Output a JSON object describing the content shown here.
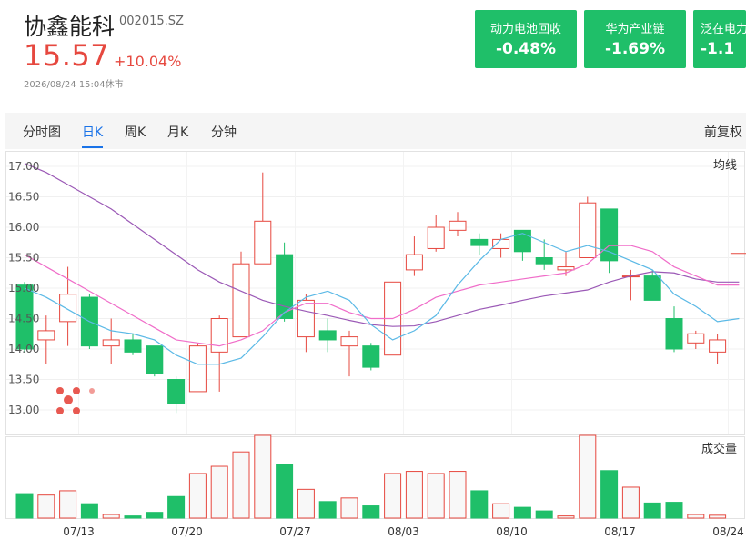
{
  "header": {
    "name": "协鑫能科",
    "code": "002015.SZ",
    "price": "15.57",
    "change": "+10.04%",
    "timestamp": "2026/08/24 15:04休市"
  },
  "sectors": [
    {
      "name": "动力电池回收",
      "value": "-0.48%"
    },
    {
      "name": "华为产业链",
      "value": "-1.69%"
    },
    {
      "name": "泛在电力",
      "value": "-1.1"
    }
  ],
  "tabs": [
    "分时图",
    "日K",
    "周K",
    "月K",
    "分钟"
  ],
  "active_tab": "日K",
  "restore_label": "前复权",
  "colors": {
    "up": "#e6483f",
    "down": "#1fbf69",
    "ma5": "#5bb9e6",
    "ma10": "#f06dc9",
    "ma20": "#9b59b6",
    "accent": "#1a73e8"
  },
  "chart_data": {
    "type": "candlestick",
    "price_legend": "均线",
    "volume_legend": "成交量",
    "ylim": [
      12.8,
      17.05
    ],
    "yticks": [
      "13.00",
      "13.50",
      "14.00",
      "14.50",
      "15.00",
      "15.50",
      "16.00",
      "16.50",
      "17.00"
    ],
    "xticks": [
      {
        "label": "07/13",
        "index": 2.5
      },
      {
        "label": "07/20",
        "index": 7.5
      },
      {
        "label": "07/27",
        "index": 12.5
      },
      {
        "label": "08/03",
        "index": 17.5
      },
      {
        "label": "08/10",
        "index": 22.5
      },
      {
        "label": "08/17",
        "index": 27.5
      },
      {
        "label": "08/24",
        "index": 32.5
      }
    ],
    "candles": [
      {
        "o": 15.05,
        "h": 15.1,
        "l": 13.95,
        "c": 14.0,
        "v": 34
      },
      {
        "o": 14.15,
        "h": 14.55,
        "l": 13.75,
        "c": 14.3,
        "v": 32
      },
      {
        "o": 14.45,
        "h": 15.35,
        "l": 14.05,
        "c": 14.9,
        "v": 38
      },
      {
        "o": 14.85,
        "h": 14.9,
        "l": 14.0,
        "c": 14.05,
        "v": 20
      },
      {
        "o": 14.05,
        "h": 14.5,
        "l": 13.75,
        "c": 14.15,
        "v": 5
      },
      {
        "o": 14.15,
        "h": 14.25,
        "l": 13.9,
        "c": 13.95,
        "v": 3
      },
      {
        "o": 14.05,
        "h": 14.05,
        "l": 13.55,
        "c": 13.6,
        "v": 8
      },
      {
        "o": 13.5,
        "h": 13.55,
        "l": 12.95,
        "c": 13.1,
        "v": 30
      },
      {
        "o": 13.3,
        "h": 14.1,
        "l": 13.3,
        "c": 14.05,
        "v": 62
      },
      {
        "o": 13.95,
        "h": 14.55,
        "l": 13.3,
        "c": 14.5,
        "v": 72
      },
      {
        "o": 14.2,
        "h": 15.6,
        "l": 14.2,
        "c": 15.4,
        "v": 92
      },
      {
        "o": 15.4,
        "h": 16.9,
        "l": 15.4,
        "c": 16.1,
        "v": 115
      },
      {
        "o": 15.55,
        "h": 15.75,
        "l": 14.45,
        "c": 14.5,
        "v": 75
      },
      {
        "o": 14.2,
        "h": 14.9,
        "l": 13.95,
        "c": 14.8,
        "v": 40
      },
      {
        "o": 14.3,
        "h": 14.5,
        "l": 13.95,
        "c": 14.15,
        "v": 23
      },
      {
        "o": 14.05,
        "h": 14.3,
        "l": 13.55,
        "c": 14.2,
        "v": 28
      },
      {
        "o": 14.05,
        "h": 14.1,
        "l": 13.65,
        "c": 13.7,
        "v": 17
      },
      {
        "o": 13.9,
        "h": 15.1,
        "l": 13.9,
        "c": 15.1,
        "v": 62
      },
      {
        "o": 15.3,
        "h": 15.85,
        "l": 15.2,
        "c": 15.55,
        "v": 65
      },
      {
        "o": 15.65,
        "h": 16.2,
        "l": 15.6,
        "c": 16.0,
        "v": 62
      },
      {
        "o": 15.95,
        "h": 16.25,
        "l": 15.85,
        "c": 16.1,
        "v": 65
      },
      {
        "o": 15.8,
        "h": 15.9,
        "l": 15.55,
        "c": 15.7,
        "v": 38
      },
      {
        "o": 15.65,
        "h": 15.9,
        "l": 15.5,
        "c": 15.8,
        "v": 20
      },
      {
        "o": 15.95,
        "h": 15.95,
        "l": 15.45,
        "c": 15.6,
        "v": 15
      },
      {
        "o": 15.5,
        "h": 15.8,
        "l": 15.3,
        "c": 15.4,
        "v": 10
      },
      {
        "o": 15.3,
        "h": 15.6,
        "l": 15.2,
        "c": 15.35,
        "v": 3
      },
      {
        "o": 15.5,
        "h": 16.5,
        "l": 15.5,
        "c": 16.4,
        "v": 115
      },
      {
        "o": 16.3,
        "h": 16.3,
        "l": 15.25,
        "c": 15.45,
        "v": 66
      },
      {
        "o": 15.2,
        "h": 15.3,
        "l": 14.8,
        "c": 15.2,
        "v": 43
      },
      {
        "o": 15.2,
        "h": 15.3,
        "l": 14.8,
        "c": 14.8,
        "v": 21
      },
      {
        "o": 14.5,
        "h": 14.7,
        "l": 13.95,
        "c": 14.0,
        "v": 22
      },
      {
        "o": 14.1,
        "h": 14.3,
        "l": 14.0,
        "c": 14.25,
        "v": 5
      },
      {
        "o": 13.95,
        "h": 14.25,
        "l": 13.75,
        "c": 14.15,
        "v": 4
      },
      {
        "o": 15.57,
        "h": 15.57,
        "l": 15.57,
        "c": 15.57,
        "v": 0
      }
    ],
    "ma5": [
      15.0,
      14.85,
      14.65,
      14.45,
      14.3,
      14.25,
      14.15,
      13.9,
      13.75,
      13.75,
      13.85,
      14.2,
      14.6,
      14.85,
      14.95,
      14.8,
      14.4,
      14.15,
      14.3,
      14.55,
      15.05,
      15.45,
      15.8,
      15.9,
      15.75,
      15.6,
      15.7,
      15.6,
      15.45,
      15.3,
      14.9,
      14.7,
      14.45,
      14.5
    ],
    "ma10": [
      15.55,
      15.35,
      15.15,
      14.95,
      14.75,
      14.55,
      14.35,
      14.15,
      14.1,
      14.05,
      14.15,
      14.3,
      14.6,
      14.75,
      14.75,
      14.6,
      14.5,
      14.5,
      14.65,
      14.85,
      14.95,
      15.05,
      15.1,
      15.15,
      15.2,
      15.25,
      15.4,
      15.7,
      15.7,
      15.6,
      15.35,
      15.2,
      15.05,
      15.05
    ],
    "ma20": [
      17.05,
      16.9,
      16.7,
      16.5,
      16.3,
      16.05,
      15.8,
      15.55,
      15.3,
      15.1,
      14.95,
      14.8,
      14.7,
      14.62,
      14.55,
      14.47,
      14.4,
      14.37,
      14.38,
      14.45,
      14.55,
      14.65,
      14.72,
      14.8,
      14.87,
      14.92,
      14.97,
      15.1,
      15.2,
      15.27,
      15.25,
      15.15,
      15.1,
      15.1
    ]
  }
}
